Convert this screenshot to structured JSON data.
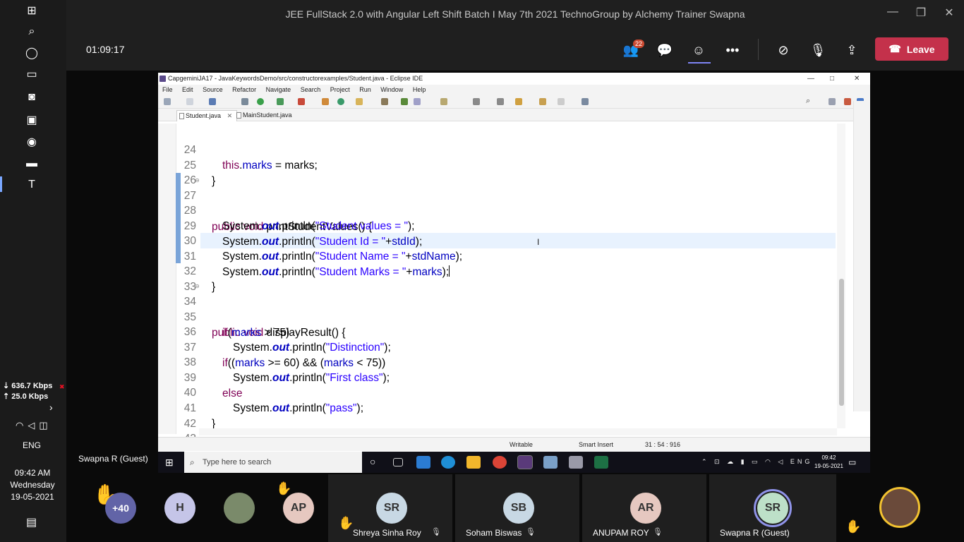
{
  "host_taskbar": {
    "network_down": "⇣ 636.7 Kbps",
    "network_up": "⇡ 25.0 Kbps",
    "language": "ENG",
    "time": "09:42 AM",
    "day": "Wednesday",
    "date": "19-05-2021"
  },
  "teams": {
    "window_title": "JEE FullStack 2.0 with Angular Left Shift Batch I May 7th 2021 TechnoGroup by Alchemy Trainer Swapna",
    "timer": "01:09:17",
    "participants_badge": "22",
    "leave_label": "Leave",
    "presenter": "Swapna R (Guest)"
  },
  "eclipse": {
    "title": "CapgeminiJA17 - JavaKeywordsDemo/src/constructorexamples/Student.java - Eclipse IDE",
    "menu": [
      "File",
      "Edit",
      "Source",
      "Refactor",
      "Navigate",
      "Search",
      "Project",
      "Run",
      "Window",
      "Help"
    ],
    "tabs": [
      {
        "label": "Student.java",
        "active": true
      },
      {
        "label": "MainStudent.java",
        "active": false
      }
    ],
    "code": {
      "l24": {
        "num": "24",
        "kw": "this",
        "t1": ".",
        "fld": "marks",
        "t2": " = ",
        "t3": "marks;"
      },
      "l25": {
        "num": "25",
        "text": "}"
      },
      "l26": {
        "num": "26"
      },
      "l27": {
        "num": "27",
        "kw": "public void",
        "text": " printStudentValues() {"
      },
      "l28": {
        "num": "28",
        "a": "System.",
        "st": "out",
        "b": ".println(",
        "str": "\"Student values = \"",
        "c": ");"
      },
      "l29": {
        "num": "29",
        "a": "System.",
        "st": "out",
        "b": ".println(",
        "str": "\"Student Id = \"",
        "c": "+",
        "fld": "stdId",
        "d": ");"
      },
      "l30": {
        "num": "30",
        "a": "System.",
        "st": "out",
        "b": ".println(",
        "str": "\"Student Name = \"",
        "c": "+",
        "fld": "stdName",
        "d": ");"
      },
      "l31": {
        "num": "31",
        "a": "System.",
        "st": "out",
        "b": ".println(",
        "str": "\"Student Marks = \"",
        "c": "+",
        "fld": "marks",
        "d": ");"
      },
      "l32": {
        "num": "32",
        "text": "}"
      },
      "l33": {
        "num": "33"
      },
      "l34": {
        "num": "34",
        "kw": "public void",
        "text": " displayResult() {"
      },
      "l35": {
        "num": "35",
        "kw": "if",
        "a": "(",
        "fld": "marks",
        "b": " > 75)"
      },
      "l36": {
        "num": "36",
        "a": "System.",
        "st": "out",
        "b": ".println(",
        "str": "\"Distinction\"",
        "c": ");"
      },
      "l37": {
        "num": "37",
        "kw": "if",
        "a": "((",
        "fld": "marks",
        "b": " >= 60) && (",
        "fld2": "marks",
        "c": " < 75))"
      },
      "l38": {
        "num": "38",
        "a": "System.",
        "st": "out",
        "b": ".println(",
        "str": "\"First class\"",
        "c": ");"
      },
      "l39": {
        "num": "39",
        "kw": "else"
      },
      "l40": {
        "num": "40",
        "a": "System.",
        "st": "out",
        "b": ".println(",
        "str": "\"pass\"",
        "c": ");"
      },
      "l41": {
        "num": "41",
        "text": "}"
      },
      "l42": {
        "num": "42"
      },
      "l43": {
        "num": "43"
      }
    },
    "status": {
      "writable": "Writable",
      "insert_mode": "Smart Insert",
      "position": "31 : 54 : 916"
    }
  },
  "shared_taskbar": {
    "search_placeholder": "Type here to search",
    "language": "ENG",
    "time": "09:42",
    "date": "19-05-2021"
  },
  "participants": {
    "overflow": "+40",
    "h_initial": "H",
    "ap_initials": "AP",
    "tiles": [
      {
        "initials": "SR",
        "name": "Shreya Sinha Roy"
      },
      {
        "initials": "SB",
        "name": "Soham Biswas"
      },
      {
        "initials": "AR",
        "name": "ANUPAM ROY"
      },
      {
        "initials": "SR",
        "name": "Swapna R (Guest)"
      }
    ]
  }
}
